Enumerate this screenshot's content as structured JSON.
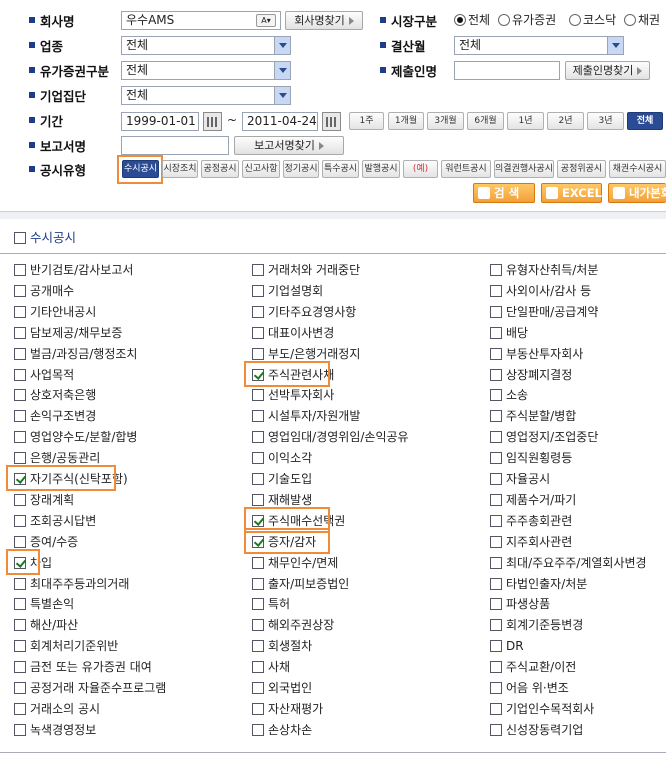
{
  "form": {
    "company": {
      "label": "회사명",
      "value": "우수AMS",
      "find_button": "회사명찾기"
    },
    "market": {
      "label": "시장구분",
      "options": [
        "전체",
        "유가증권",
        "코스닥",
        "채권"
      ],
      "selected": "전체"
    },
    "industry": {
      "label": "업종",
      "value": "전체"
    },
    "settlement": {
      "label": "결산월",
      "value": "전체"
    },
    "securities_type": {
      "label": "유가증권구분",
      "value": "전체"
    },
    "submitter": {
      "label": "제출인명",
      "value": "",
      "find_button": "제출인명찾기"
    },
    "group": {
      "label": "기업집단",
      "value": "전체"
    },
    "period": {
      "label": "기간",
      "start": "1999-01-01",
      "tilde": "~",
      "end": "2011-04-24",
      "quick": [
        "1주",
        "1개월",
        "3개월",
        "6개월",
        "1년",
        "2년",
        "3년",
        "전체"
      ],
      "selected": "전체"
    },
    "report_name": {
      "label": "보고서명",
      "value": "",
      "find_button": "보고서명찾기"
    },
    "disclosure_type": {
      "label": "공시유형",
      "types": [
        "수시공시",
        "시장조치",
        "공정공시",
        "신고사항",
        "정기공시",
        "특수공시",
        "발행공시",
        "(예)",
        "워런트공시",
        "의결권행사공시",
        "공정위공시",
        "채권수시공시"
      ],
      "selected": "수시공시"
    },
    "search_button": "검  색",
    "excel_button": "EXCEL",
    "myreport_button": "내가본회"
  },
  "section": {
    "title": "수시공시",
    "checked": false
  },
  "checklist": {
    "col1": [
      {
        "label": "반기검토/감사보고서",
        "checked": false
      },
      {
        "label": "공개매수",
        "checked": false
      },
      {
        "label": "기타안내공시",
        "checked": false
      },
      {
        "label": "담보제공/채무보증",
        "checked": false
      },
      {
        "label": "벌금/과징금/행정조치",
        "checked": false
      },
      {
        "label": "사업목적",
        "checked": false
      },
      {
        "label": "상호저축은행",
        "checked": false
      },
      {
        "label": "손익구조변경",
        "checked": false
      },
      {
        "label": "영업양수도/분할/합병",
        "checked": false
      },
      {
        "label": "은행/공동관리",
        "checked": false
      },
      {
        "label": "자기주식(신탁포함)",
        "checked": true
      },
      {
        "label": "장래계획",
        "checked": false
      },
      {
        "label": "조회공시답변",
        "checked": false
      },
      {
        "label": "증여/수증",
        "checked": false
      },
      {
        "label": "차입",
        "checked": true
      },
      {
        "label": "최대주주등과의거래",
        "checked": false
      },
      {
        "label": "특별손익",
        "checked": false
      },
      {
        "label": "해산/파산",
        "checked": false
      },
      {
        "label": "회계처리기준위반",
        "checked": false
      },
      {
        "label": "금전 또는 유가증권 대여",
        "checked": false
      },
      {
        "label": "공정거래 자율준수프로그램",
        "checked": false
      },
      {
        "label": "거래소의 공시",
        "checked": false
      },
      {
        "label": "녹색경영정보",
        "checked": false
      }
    ],
    "col2": [
      {
        "label": "거래처와 거래중단",
        "checked": false
      },
      {
        "label": "기업설명회",
        "checked": false
      },
      {
        "label": "기타주요경영사항",
        "checked": false
      },
      {
        "label": "대표이사변경",
        "checked": false
      },
      {
        "label": "부도/은행거래정지",
        "checked": false
      },
      {
        "label": "주식관련사채",
        "checked": true
      },
      {
        "label": "선박투자회사",
        "checked": false
      },
      {
        "label": "시설투자/자원개발",
        "checked": false
      },
      {
        "label": "영업임대/경영위임/손익공유",
        "checked": false
      },
      {
        "label": "이익소각",
        "checked": false
      },
      {
        "label": "기술도입",
        "checked": false
      },
      {
        "label": "재해발생",
        "checked": false
      },
      {
        "label": "주식매수선택권",
        "checked": true
      },
      {
        "label": "증자/감자",
        "checked": true
      },
      {
        "label": "채무인수/면제",
        "checked": false
      },
      {
        "label": "출자/피보증법인",
        "checked": false
      },
      {
        "label": "특허",
        "checked": false
      },
      {
        "label": "해외주권상장",
        "checked": false
      },
      {
        "label": "회생절차",
        "checked": false
      },
      {
        "label": "사채",
        "checked": false
      },
      {
        "label": "외국법인",
        "checked": false
      },
      {
        "label": "자산재평가",
        "checked": false
      },
      {
        "label": "손상차손",
        "checked": false
      }
    ],
    "col3": [
      {
        "label": "유형자산취득/처분",
        "checked": false
      },
      {
        "label": "사외이사/감사 등",
        "checked": false
      },
      {
        "label": "단일판매/공급계약",
        "checked": false
      },
      {
        "label": "배당",
        "checked": false
      },
      {
        "label": "부동산투자회사",
        "checked": false
      },
      {
        "label": "상장폐지결정",
        "checked": false
      },
      {
        "label": "소송",
        "checked": false
      },
      {
        "label": "주식분할/병합",
        "checked": false
      },
      {
        "label": "영업정지/조업중단",
        "checked": false
      },
      {
        "label": "임직원횡령등",
        "checked": false
      },
      {
        "label": "자율공시",
        "checked": false
      },
      {
        "label": "제품수거/파기",
        "checked": false
      },
      {
        "label": "주주총회관련",
        "checked": false
      },
      {
        "label": "지주회사관련",
        "checked": false
      },
      {
        "label": "최대/주요주주/계열회사변경",
        "checked": false
      },
      {
        "label": "타법인출자/처분",
        "checked": false
      },
      {
        "label": "파생상품",
        "checked": false
      },
      {
        "label": "회계기준등변경",
        "checked": false
      },
      {
        "label": "DR",
        "checked": false
      },
      {
        "label": "주식교환/이전",
        "checked": false
      },
      {
        "label": "어음 위·변조",
        "checked": false
      },
      {
        "label": "기업인수목적회사",
        "checked": false
      },
      {
        "label": "신성장동력기업",
        "checked": false
      }
    ]
  }
}
